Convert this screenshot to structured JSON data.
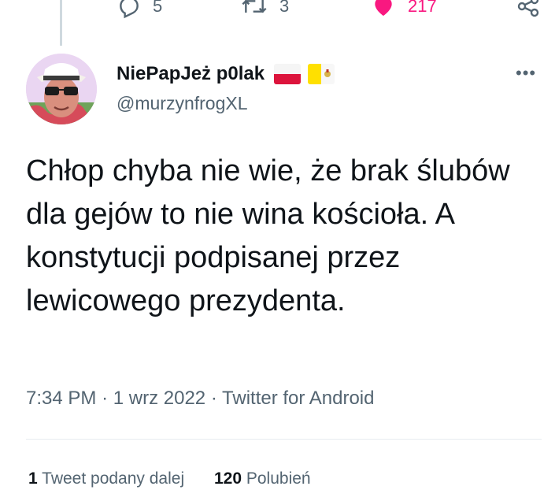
{
  "actions": {
    "reply_count": "5",
    "retweet_count": "3",
    "like_count": "217"
  },
  "user": {
    "display_name": "NiePapJeż p0lak",
    "handle": "@murzynfrogXL",
    "flags": [
      "poland-flag",
      "vatican-flag"
    ]
  },
  "tweet": {
    "text": "Chłop chyba nie wie, że brak ślubów dla gejów to nie wina kościoła. A konstytucji podpisanej przez lewicowego prezydenta.",
    "time": "7:34 PM",
    "separator": "·",
    "date": "1 wrz 2022",
    "source": "Twitter for Android"
  },
  "stats": {
    "retweets_num": "1",
    "retweets_label": "Tweet podany dalej",
    "likes_num": "120",
    "likes_label": "Polubień"
  },
  "colors": {
    "text": "#0f1419",
    "secondary": "#536471",
    "like": "#f91880",
    "divider": "#e6ecf0"
  }
}
